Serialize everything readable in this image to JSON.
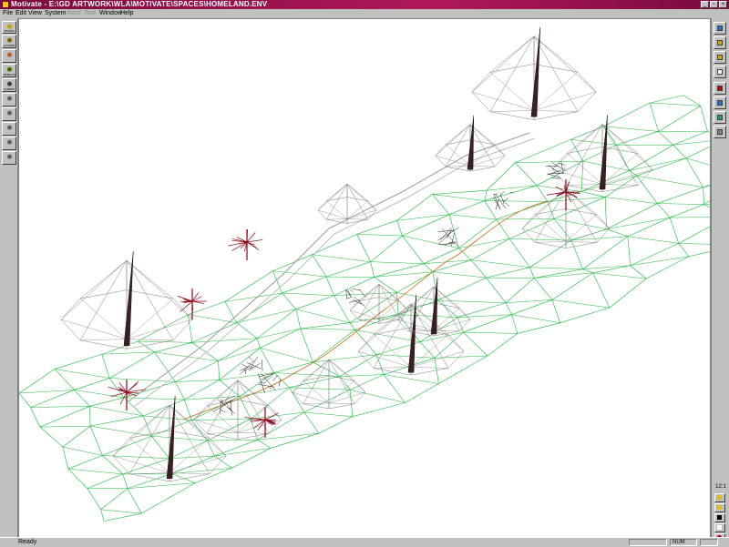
{
  "window": {
    "title": "Motivate - E:\\GD ARTWORK\\WLA\\MOTIVATE\\SPACES\\HOMELAND.ENV"
  },
  "menu": {
    "items": [
      {
        "label": "File",
        "enabled": true
      },
      {
        "label": "Edit",
        "enabled": true
      },
      {
        "label": "View",
        "enabled": true
      },
      {
        "label": "System",
        "enabled": true
      },
      {
        "label": "Actor",
        "enabled": false
      },
      {
        "label": "Tool",
        "enabled": false
      },
      {
        "label": "Window",
        "enabled": true
      },
      {
        "label": "Help",
        "enabled": true
      }
    ]
  },
  "left_toolbar": {
    "tools": [
      {
        "icon": "world-icon",
        "label": "WORLD"
      },
      {
        "icon": "actors-icon",
        "label": "ACTORS"
      },
      {
        "icon": "paint-icon",
        "label": ""
      },
      {
        "icon": "objects-icon",
        "label": "OBJECTS"
      },
      {
        "icon": "camera-icon",
        "label": "CAMERA"
      },
      {
        "icon": "pointer-icon",
        "label": ""
      },
      {
        "icon": "walk-icon",
        "label": ""
      },
      {
        "icon": "run-icon",
        "label": ""
      },
      {
        "icon": "figure-icon",
        "label": ""
      },
      {
        "icon": "figure-pose-icon",
        "label": ""
      }
    ]
  },
  "right_toolbar": {
    "tools": [
      {
        "icon": "search-icon",
        "color": "#1f6fd0"
      },
      {
        "icon": "rotate-icon",
        "color": "#e0a000"
      },
      {
        "icon": "move-icon",
        "color": "#e0a000"
      },
      {
        "icon": "document-icon",
        "color": "#ffffff"
      },
      {
        "icon": "red-square-icon",
        "color": "#c00000"
      },
      {
        "icon": "blue-box-icon",
        "color": "#1f6fd0"
      },
      {
        "icon": "globe-icon",
        "color": "#1aa05a"
      },
      {
        "icon": "stack-icon",
        "color": "#808080"
      }
    ],
    "zoom_label": "12:1",
    "bottom_tools": [
      {
        "icon": "diamond-yellow-icon",
        "color": "#e0c000"
      },
      {
        "icon": "arrow-yellow-icon",
        "color": "#e0c000"
      },
      {
        "icon": "pointer-icon",
        "color": "#000000"
      },
      {
        "icon": "hand-icon",
        "color": "#ffffff"
      },
      {
        "icon": "record-icon",
        "color": "#c00000"
      }
    ]
  },
  "colors": {
    "terrain_mesh": "#19b83a",
    "tree_wireframe": "#808080",
    "tree_red": "#8b0018",
    "path": "#cc6a10",
    "objects": "#202020"
  },
  "status": {
    "text": "Ready",
    "num": "NUM"
  }
}
